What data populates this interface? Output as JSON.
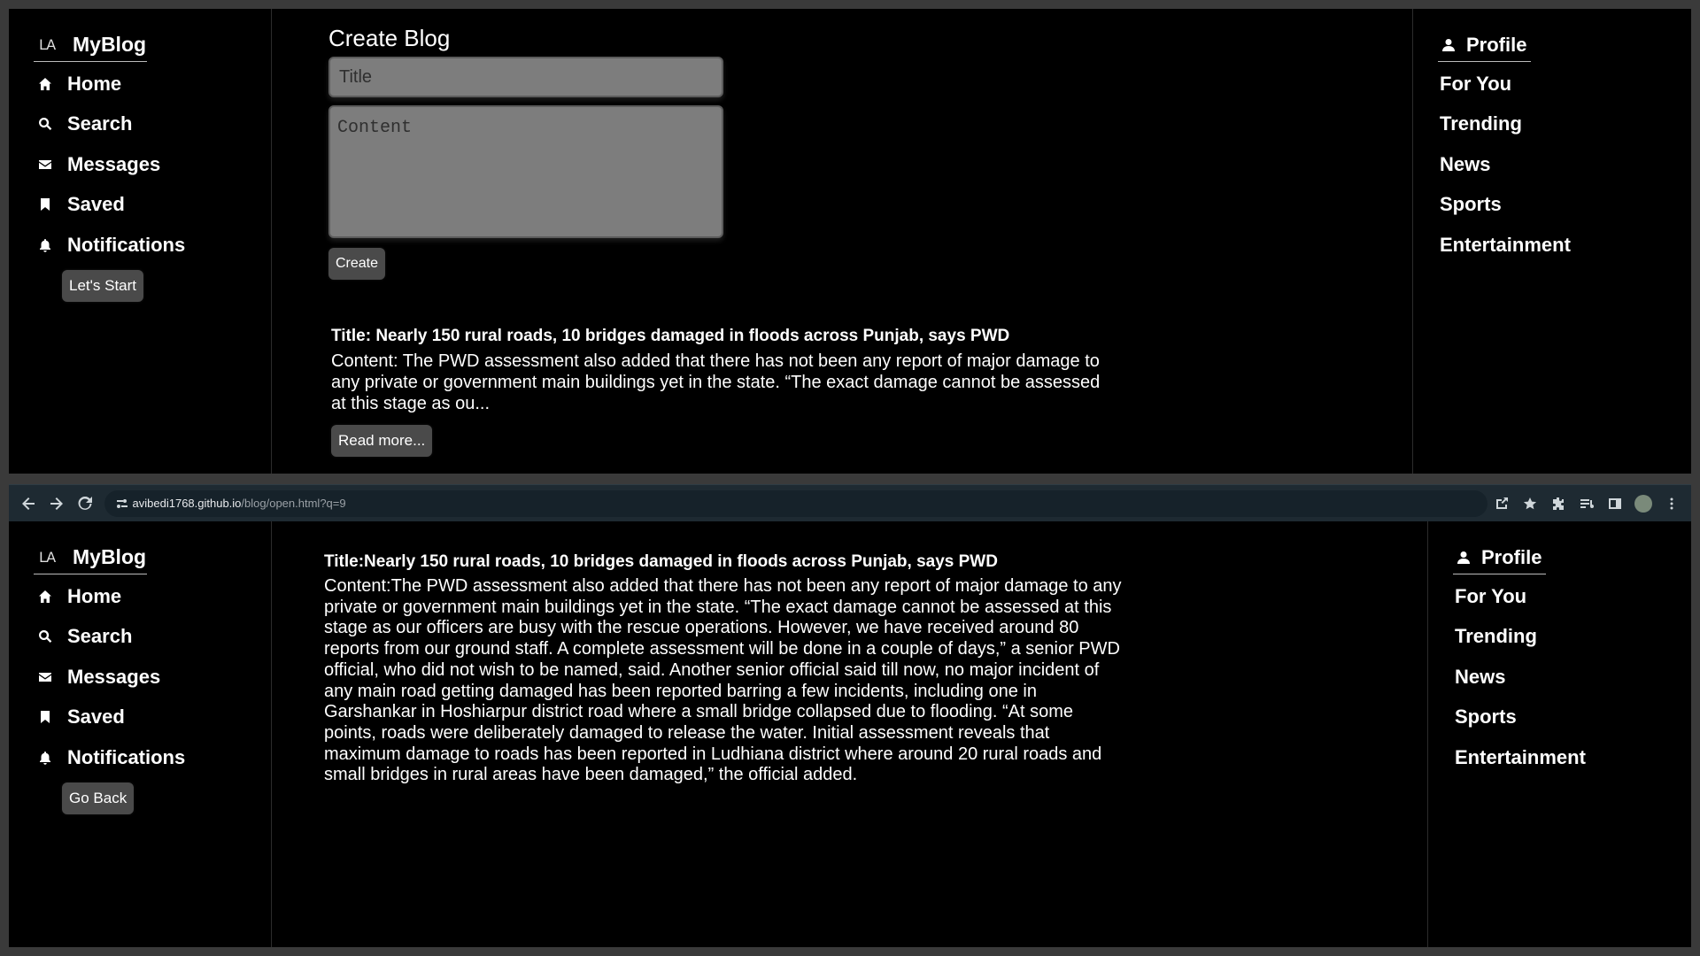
{
  "brand": {
    "logo": "LA",
    "name": "MyBlog"
  },
  "left_nav": [
    {
      "label": "Home",
      "icon": "home-icon"
    },
    {
      "label": "Search",
      "icon": "search-icon"
    },
    {
      "label": "Messages",
      "icon": "envelope-icon"
    },
    {
      "label": "Saved",
      "icon": "bookmark-icon"
    },
    {
      "label": "Notifications",
      "icon": "bell-icon"
    }
  ],
  "right_nav": {
    "profile": "Profile",
    "items": [
      "For You",
      "Trending",
      "News",
      "Sports",
      "Entertainment"
    ]
  },
  "top": {
    "start_button": "Let's Start",
    "create_heading": "Create Blog",
    "title_placeholder": "Title",
    "content_placeholder": "Content",
    "create_button": "Create",
    "post": {
      "title": "Title: Nearly 150 rural roads, 10 bridges damaged in floods across Punjab, says PWD",
      "content": "Content: The PWD assessment also added that there has not been any report of major damage to any private or government main buildings yet in the state. “The exact damage cannot be assessed at this stage as ou...",
      "read_more": "Read more..."
    }
  },
  "browser": {
    "url_host": "avibedi1768.github.io",
    "url_path": "/blog/open.html?q=9"
  },
  "bottom": {
    "back_button": "Go Back",
    "article": {
      "title": "Title:Nearly 150 rural roads, 10 bridges damaged in floods across Punjab, says PWD",
      "content": "Content:The PWD assessment also added that there has not been any report of major damage to any private or government main buildings yet in the state. “The exact damage cannot be assessed at this stage as our officers are busy with the rescue operations. However, we have received around 80 reports from our ground staff. A complete assessment will be done in a couple of days,” a senior PWD official, who did not wish to be named, said. Another senior official said till now, no major incident of any main road getting damaged has been reported barring a few incidents, including one in Garshankar in Hoshiarpur district road where a small bridge collapsed due to flooding. “At some points, roads were deliberately damaged to release the water. Initial assessment reveals that maximum damage to roads has been reported in Ludhiana district where around 20 rural roads and small bridges in rural areas have been damaged,” the official added."
    }
  }
}
